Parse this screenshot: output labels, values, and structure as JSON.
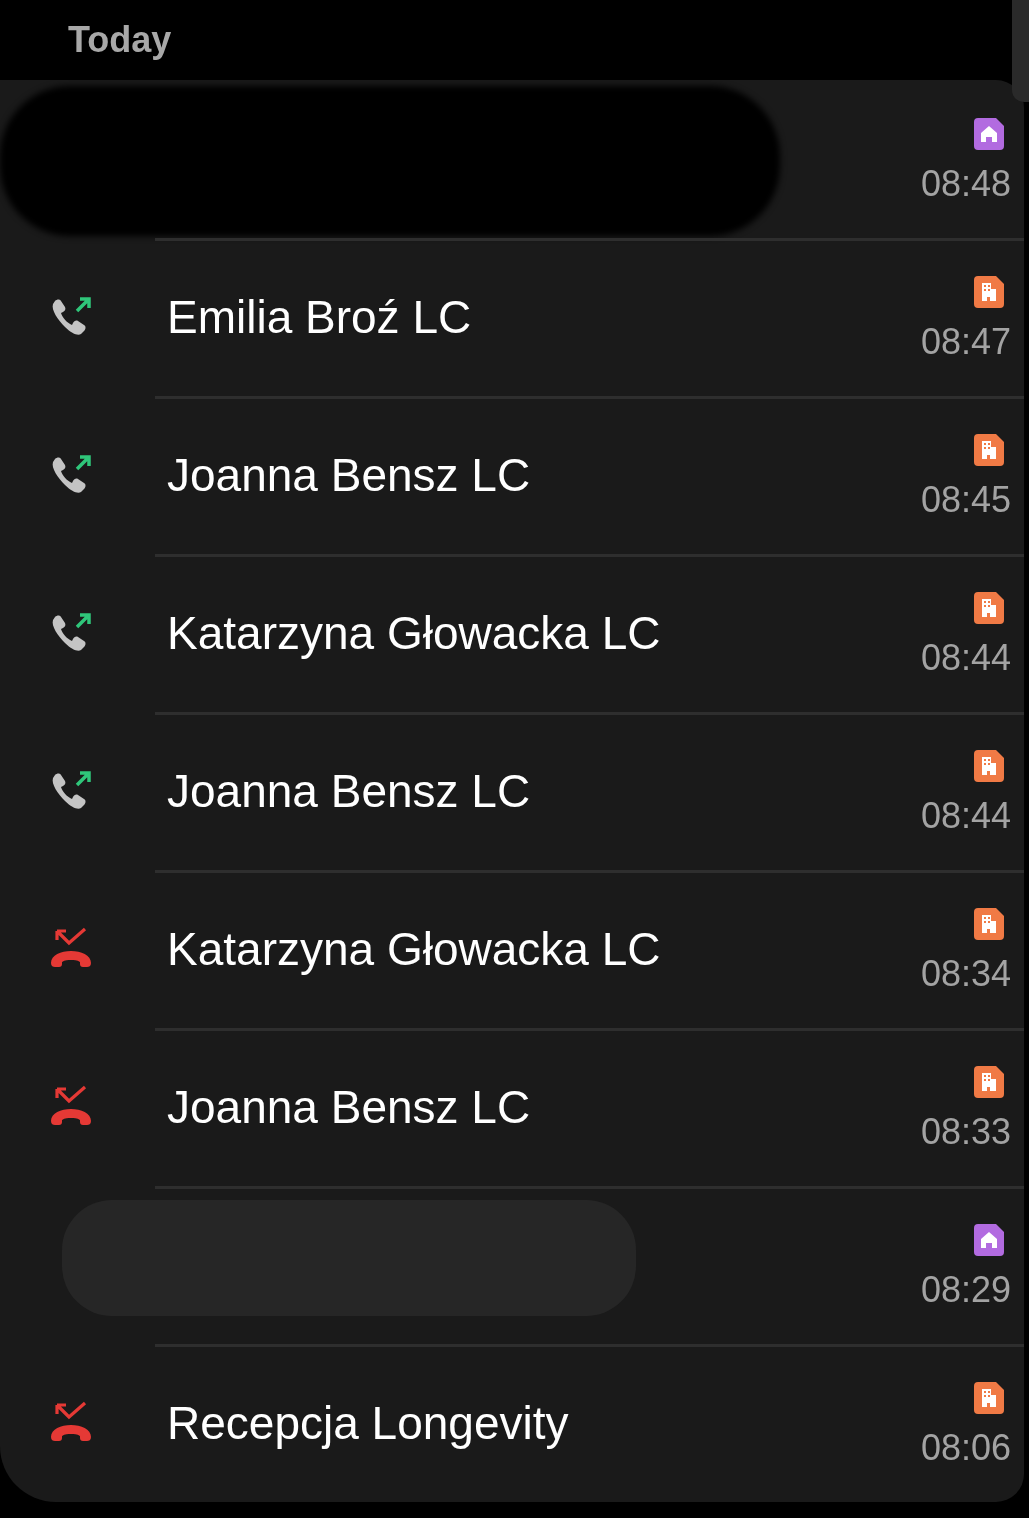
{
  "section_header": "Today",
  "calls": [
    {
      "kind": "redacted",
      "name_redacted": true,
      "label": {
        "kind": "home"
      },
      "time": "08:48"
    },
    {
      "kind": "outgoing",
      "name": "Emilia Broź LC",
      "label": {
        "kind": "work"
      },
      "time": "08:47"
    },
    {
      "kind": "outgoing",
      "name": "Joanna Bensz LC",
      "label": {
        "kind": "work"
      },
      "time": "08:45"
    },
    {
      "kind": "outgoing",
      "name": "Katarzyna Głowacka LC",
      "label": {
        "kind": "work"
      },
      "time": "08:44"
    },
    {
      "kind": "outgoing",
      "name": "Joanna Bensz LC",
      "label": {
        "kind": "work"
      },
      "time": "08:44"
    },
    {
      "kind": "missed",
      "name": "Katarzyna Głowacka LC",
      "label": {
        "kind": "work"
      },
      "time": "08:34"
    },
    {
      "kind": "missed",
      "name": "Joanna Bensz LC",
      "label": {
        "kind": "work"
      },
      "time": "08:33"
    },
    {
      "kind": "redacted_light",
      "name_redacted": true,
      "label": {
        "kind": "home"
      },
      "time": "08:29"
    },
    {
      "kind": "missed",
      "name": "Recepcja Longevity",
      "label": {
        "kind": "work"
      },
      "time": "08:06"
    }
  ]
}
